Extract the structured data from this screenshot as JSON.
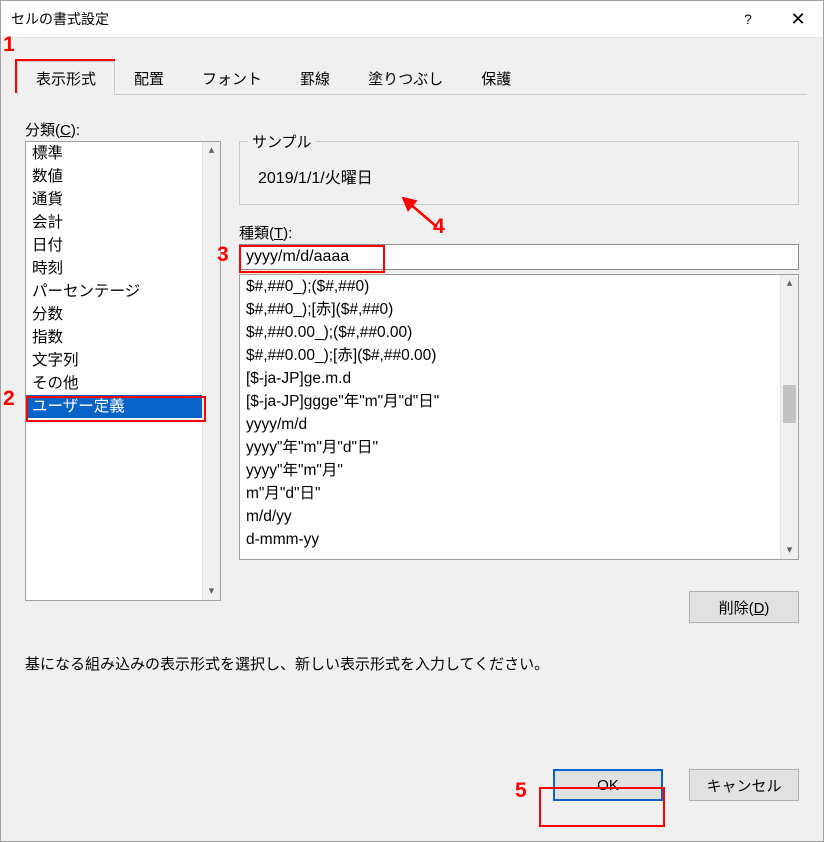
{
  "window": {
    "title": "セルの書式設定",
    "help": "?",
    "close": "✕"
  },
  "tabs": [
    {
      "label": "表示形式",
      "active": true
    },
    {
      "label": "配置",
      "active": false
    },
    {
      "label": "フォント",
      "active": false
    },
    {
      "label": "罫線",
      "active": false
    },
    {
      "label": "塗りつぶし",
      "active": false
    },
    {
      "label": "保護",
      "active": false
    }
  ],
  "category": {
    "label_pre": "分類(",
    "label_key": "C",
    "label_post": "):",
    "items": [
      {
        "text": "標準",
        "selected": false
      },
      {
        "text": "数値",
        "selected": false
      },
      {
        "text": "通貨",
        "selected": false
      },
      {
        "text": "会計",
        "selected": false
      },
      {
        "text": "日付",
        "selected": false
      },
      {
        "text": "時刻",
        "selected": false
      },
      {
        "text": "パーセンテージ",
        "selected": false
      },
      {
        "text": "分数",
        "selected": false
      },
      {
        "text": "指数",
        "selected": false
      },
      {
        "text": "文字列",
        "selected": false
      },
      {
        "text": "その他",
        "selected": false
      },
      {
        "text": "ユーザー定義",
        "selected": true
      }
    ]
  },
  "sample": {
    "legend": "サンプル",
    "value": "2019/1/1/火曜日"
  },
  "type": {
    "label_pre": "種類(",
    "label_key": "T",
    "label_post": "):",
    "value": "yyyy/m/d/aaaa",
    "items": [
      "$#,##0_);($#,##0)",
      "$#,##0_);[赤]($#,##0)",
      "$#,##0.00_);($#,##0.00)",
      "$#,##0.00_);[赤]($#,##0.00)",
      "[$-ja-JP]ge.m.d",
      "[$-ja-JP]ggge\"年\"m\"月\"d\"日\"",
      "yyyy/m/d",
      "yyyy\"年\"m\"月\"d\"日\"",
      "yyyy\"年\"m\"月\"",
      "m\"月\"d\"日\"",
      "m/d/yy",
      "d-mmm-yy"
    ]
  },
  "buttons": {
    "delete_pre": "削除(",
    "delete_key": "D",
    "delete_post": ")",
    "ok": "OK",
    "cancel": "キャンセル"
  },
  "help_text": "基になる組み込みの表示形式を選択し、新しい表示形式を入力してください。",
  "annotations": {
    "n1": "1",
    "n2": "2",
    "n3": "3",
    "n4": "4",
    "n5": "5"
  }
}
